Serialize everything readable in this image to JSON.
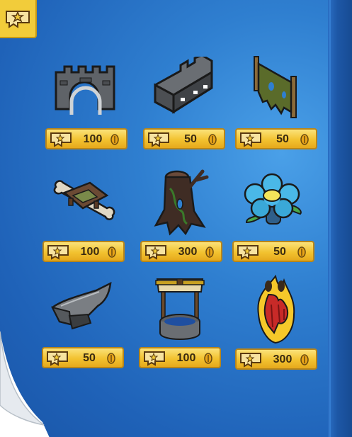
{
  "catalog": {
    "items": [
      {
        "icon": "stone-castle-arch-icon",
        "price": "100"
      },
      {
        "icon": "stone-fort-wall-icon",
        "price": "50"
      },
      {
        "icon": "tattered-banner-icon",
        "price": "50"
      },
      {
        "icon": "bone-rug-icon",
        "price": "100"
      },
      {
        "icon": "dead-tree-stump-icon",
        "price": "300"
      },
      {
        "icon": "blue-flower-icon",
        "price": "50"
      },
      {
        "icon": "anvil-icon",
        "price": "50"
      },
      {
        "icon": "wishing-well-icon",
        "price": "100"
      },
      {
        "icon": "fire-pit-icon",
        "price": "300"
      }
    ]
  },
  "colors": {
    "page": "#2f7fd0",
    "price_tag": "#f2c230",
    "badge": "#f2cc3a"
  }
}
